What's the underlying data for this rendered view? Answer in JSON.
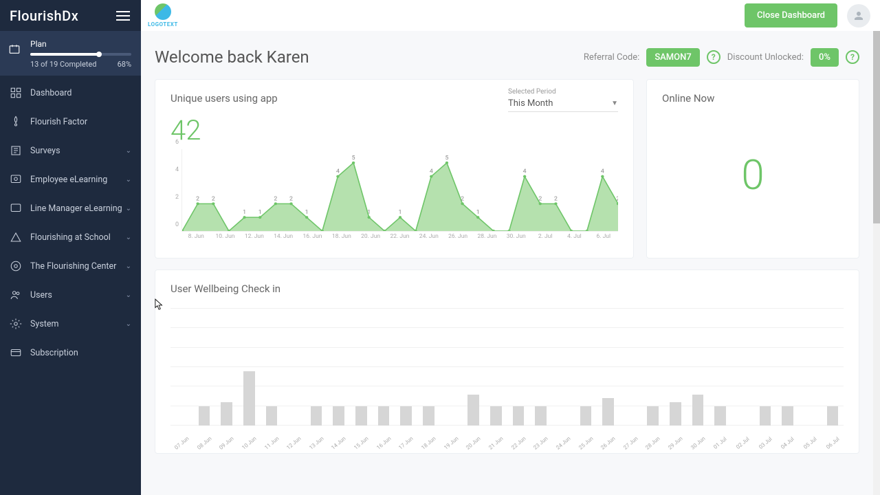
{
  "topbar": {
    "brand": "FlourishDx",
    "logo_text": "LOGOTEXT",
    "close_label": "Close Dashboard"
  },
  "sidebar": {
    "plan": {
      "label": "Plan",
      "progress_text": "13 of 19 Completed",
      "percent_text": "68%",
      "percent": 68
    },
    "items": [
      {
        "label": "Dashboard",
        "expandable": false
      },
      {
        "label": "Flourish Factor",
        "expandable": false
      },
      {
        "label": "Surveys",
        "expandable": true
      },
      {
        "label": "Employee eLearning",
        "expandable": true
      },
      {
        "label": "Line Manager eLearning",
        "expandable": true
      },
      {
        "label": "Flourishing at School",
        "expandable": true
      },
      {
        "label": "The Flourishing Center",
        "expandable": true
      },
      {
        "label": "Users",
        "expandable": true
      },
      {
        "label": "System",
        "expandable": true
      },
      {
        "label": "Subscription",
        "expandable": false
      }
    ]
  },
  "header": {
    "welcome": "Welcome back Karen",
    "referral_label": "Referral Code:",
    "referral_code": "SAMON7",
    "discount_label": "Discount Unlocked:",
    "discount_value": "0%"
  },
  "card_users": {
    "title": "Unique users using app",
    "period_label": "Selected Period",
    "period_value": "This Month",
    "value": "42"
  },
  "card_online": {
    "title": "Online Now",
    "value": "0"
  },
  "card_wellbeing": {
    "title": "User Wellbeing Check in"
  },
  "chart_data": [
    {
      "type": "area",
      "title": "Unique users using app",
      "x": [
        "8. Jun",
        "10. Jun",
        "12. Jun",
        "14. Jun",
        "16. Jun",
        "18. Jun",
        "20. Jun",
        "22. Jun",
        "24. Jun",
        "26. Jun",
        "28. Jun",
        "30. Jun",
        "2. Jul",
        "4. Jul",
        "6. Jul"
      ],
      "values_per_day": [
        0,
        2,
        2,
        0,
        1,
        1,
        2,
        2,
        1,
        0,
        4,
        5,
        1,
        0,
        1,
        0,
        4,
        5,
        2,
        1,
        0,
        0,
        4,
        2,
        2,
        0,
        0,
        4,
        2
      ],
      "y_ticks": [
        0,
        2,
        4,
        6
      ],
      "ylim": [
        0,
        6
      ]
    },
    {
      "type": "bar",
      "title": "User Wellbeing Check in",
      "categories": [
        "07 Jun",
        "08 Jun",
        "09 Jun",
        "10 Jun",
        "11 Jun",
        "12 Jun",
        "13 Jun",
        "14 Jun",
        "15 Jun",
        "16 Jun",
        "17 Jun",
        "18 Jun",
        "19 Jun",
        "20 Jun",
        "21 Jun",
        "22 Jun",
        "23 Jun",
        "24 Jun",
        "25 Jun",
        "26 Jun",
        "27 Jun",
        "28 Jun",
        "29 Jun",
        "30 Jun",
        "01 Jul",
        "02 Jul",
        "03 Jul",
        "04 Jul",
        "05 Jul",
        "06 Jul"
      ],
      "values": [
        0,
        5,
        6,
        14,
        5,
        0,
        5,
        5,
        5,
        5,
        5,
        5,
        0,
        8,
        5,
        5,
        5,
        0,
        5,
        7,
        0,
        5,
        6,
        8,
        5,
        0,
        5,
        5,
        0,
        5
      ],
      "ylim": [
        0,
        30
      ]
    }
  ]
}
